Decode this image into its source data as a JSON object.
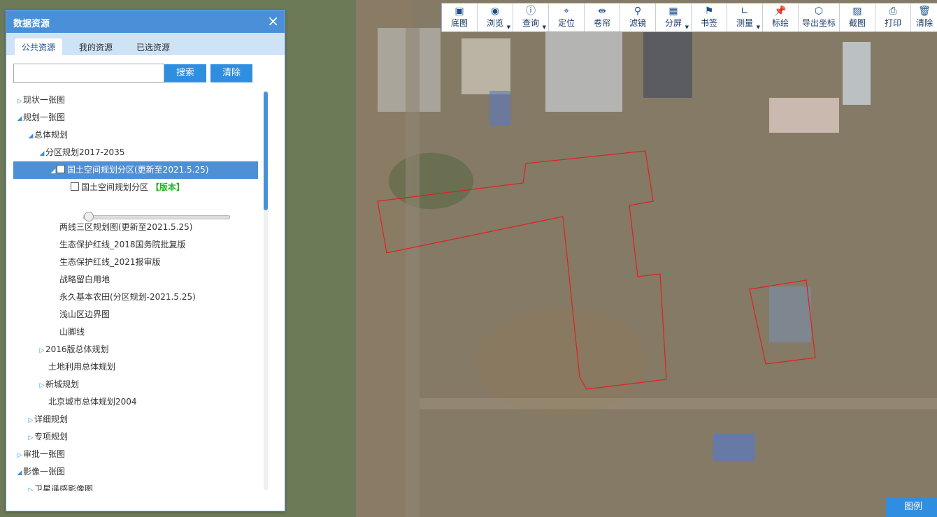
{
  "panel": {
    "title": "数据资源",
    "close": "×"
  },
  "tabs": [
    "公共资源",
    "我的资源",
    "已选资源"
  ],
  "search": {
    "placeholder": "",
    "search_label": "搜索",
    "clear_label": "清除"
  },
  "tree": {
    "n0": "现状一张图",
    "n1": "规划一张图",
    "n2": "总体规划",
    "n3": "分区规划2017-2035",
    "n4": "国土空间规划分区(更新至2021.5.25)",
    "n5": "国土空间规划分区",
    "n5_ver": "【版本】",
    "n6": "两线三区规划图(更新至2021.5.25)",
    "n7": "生态保护红线_2018国务院批复版",
    "n8": "生态保护红线_2021报审版",
    "n9": "战略留白用地",
    "n10": "永久基本农田(分区规划-2021.5.25)",
    "n11": "浅山区边界图",
    "n12": "山脚线",
    "n13": "2016版总体规划",
    "n14": "土地利用总体规划",
    "n15": "新城规划",
    "n16": "北京城市总体规划2004",
    "n17": "详细规划",
    "n18": "专项规划",
    "n19": "审批一张图",
    "n20": "影像一张图",
    "n21": "卫星遥感影像图"
  },
  "slider": {
    "value": 0
  },
  "toolbar": {
    "t0": "底图",
    "t1": "浏览",
    "t2": "查询",
    "t3": "定位",
    "t4": "卷帘",
    "t5": "滤镜",
    "t6": "分屏",
    "t7": "书签",
    "t8": "测量",
    "t9": "标绘",
    "t10": "导出坐标",
    "t11": "截图",
    "t12": "打印",
    "t13": "清除"
  },
  "legend": "图例",
  "colors": {
    "accent": "#4a90d9",
    "button": "#2f8ee0",
    "boundary": "#e02020",
    "version": "#1fb51f"
  }
}
